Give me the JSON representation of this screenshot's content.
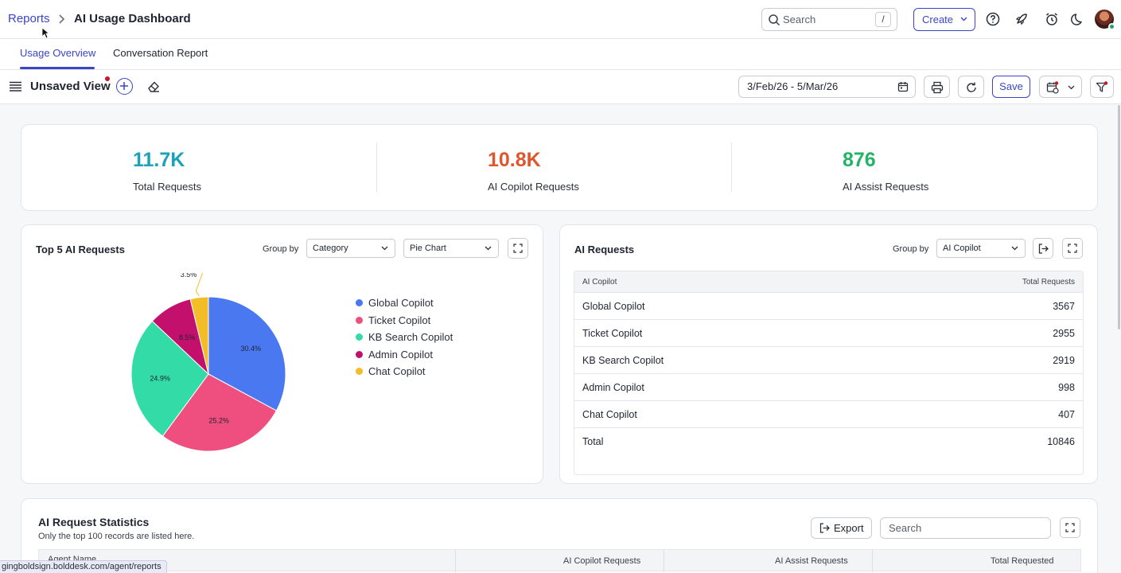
{
  "header": {
    "breadcrumb_link": "Reports",
    "title": "AI Usage Dashboard",
    "search_placeholder": "Search",
    "search_shortcut": "/",
    "create_label": "Create"
  },
  "tabs": [
    {
      "label": "Usage Overview",
      "active": true
    },
    {
      "label": "Conversation Report",
      "active": false
    }
  ],
  "toolbar": {
    "view_title": "Unsaved View",
    "date_range": "3/Feb/26 - 5/Mar/26",
    "save_label": "Save"
  },
  "kpis": [
    {
      "value": "11.7K",
      "label": "Total Requests",
      "color": "#1aa3b8"
    },
    {
      "value": "10.8K",
      "label": "AI Copilot Requests",
      "color": "#e0562a"
    },
    {
      "value": "876",
      "label": "AI Assist Requests",
      "color": "#22b366"
    }
  ],
  "top5": {
    "title": "Top 5 AI Requests",
    "group_by_label": "Group by",
    "group_by_value": "Category",
    "chart_type_value": "Pie Chart",
    "legend": [
      {
        "label": "Global Copilot",
        "color": "#4a78f0"
      },
      {
        "label": "Ticket Copilot",
        "color": "#ee4f7e"
      },
      {
        "label": "KB Search Copilot",
        "color": "#33dba7"
      },
      {
        "label": "Admin Copilot",
        "color": "#c3106d"
      },
      {
        "label": "Chat Copilot",
        "color": "#f2bd27"
      }
    ],
    "slice_labels": [
      "30.4%",
      "25.2%",
      "24.9%",
      "8.5%",
      "3.5%"
    ]
  },
  "chart_data": {
    "type": "pie",
    "categories": [
      "Global Copilot",
      "Ticket Copilot",
      "KB Search Copilot",
      "Admin Copilot",
      "Chat Copilot"
    ],
    "values": [
      30.4,
      25.2,
      24.9,
      8.5,
      3.5
    ],
    "colors": [
      "#4a78f0",
      "#ee4f7e",
      "#33dba7",
      "#c3106d",
      "#f2bd27"
    ],
    "title": "Top 5 AI Requests",
    "legend": "right"
  },
  "ai_requests": {
    "title": "AI Requests",
    "group_by_label": "Group by",
    "group_by_value": "AI Copilot",
    "columns": [
      "AI Copilot",
      "Total Requests"
    ],
    "rows": [
      {
        "name": "Global Copilot",
        "value": "3567"
      },
      {
        "name": "Ticket Copilot",
        "value": "2955"
      },
      {
        "name": "KB Search Copilot",
        "value": "2919"
      },
      {
        "name": "Admin Copilot",
        "value": "998"
      },
      {
        "name": "Chat Copilot",
        "value": "407"
      },
      {
        "name": "Total",
        "value": "10846"
      }
    ]
  },
  "stats": {
    "title": "AI Request Statistics",
    "subtitle": "Only the top 100 records are listed here.",
    "export_label": "Export",
    "search_placeholder": "Search",
    "columns": [
      "Agent Name",
      "AI Copilot Requests",
      "AI Assist Requests",
      "Total Requested"
    ]
  },
  "status_url": "gingboldsign.bolddesk.com/agent/reports"
}
